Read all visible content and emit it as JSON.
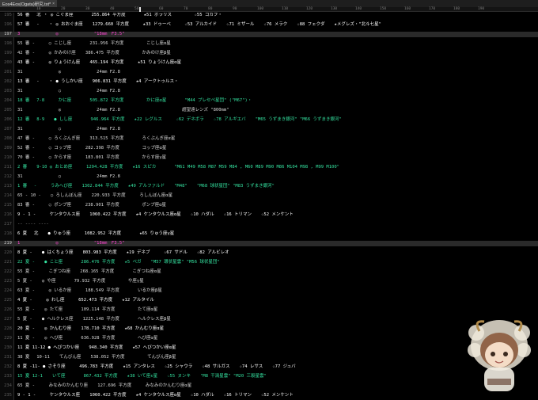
{
  "window": {
    "tab_label": "Eos4Eos(Ogata)研究.txt*"
  },
  "ruler": {
    "ticks": [
      "10",
      "20",
      "30",
      "40",
      "50",
      "60",
      "70",
      "80",
      "90",
      "100",
      "110",
      "120",
      "130",
      "140",
      "150",
      "160",
      "170",
      "180",
      "190"
    ]
  },
  "lines": [
    {
      "n": "195",
      "t": "56 審 　北 ・ ◎ こぐま座 　　　 255.864 平方度 　　　 ★51 ポラリス 　　　　 ☆55 コカブ・"
    },
    {
      "n": "196",
      "t": "57 審 　- 　 ・ ◎ おおぐま座 　 1279.660 平方度 　　 ★33 ドゥーベ 　　 ☆53 アルカイド 　 ☆71 ミザール 　 ☆76 メラク 　 ☆88 フェクダ 　 ★メグレズ・\"北斗七星\""
    },
    {
      "n": "197",
      "t": "3 　　　　　　　 ◎ 　　　　　　　 \"18mm　F3.5\""
    },
    {
      "n": "198",
      "t": "55 審 - 　　 ○ こじし座 　　　 231.956 平方度 　　　　 こじし座α星"
    },
    {
      "n": "199",
      "t": "42 審 - 　　 ◎ かみのけ座 　 386.475 平方度 　　　　 かみのけ座β星"
    },
    {
      "n": "200",
      "t": "43 審 - 　　 ◎ りょうけん座 　 465.194 平方度 　　 ★51 りょうけん座α星"
    },
    {
      "n": "201",
      "t": "31 　　　　　　　 ◎ 　　　　　　　 24mm F2.8"
    },
    {
      "n": "202",
      "t": "13 審 　- 　 ・ ● うしかい座 　 906.831 平方度 　 ★4 アークトゥルス・"
    },
    {
      "n": "203",
      "t": "31 　　　　　　　 ○ 　　　　　　　 24mm F2.8"
    },
    {
      "n": "204",
      "t": "18 審 　7-8 　　 かに座 　　　 505.872 平方度 　　　　 かに座α星 　　　 \"M44 プレセペ星団\" (\"M67\")・"
    },
    {
      "n": "205",
      "t": "31 　　　　　　　 ◎ 　　　　　　　 24mm F2.8 　　　　　　　　　　　　　 超望遠レンズ \"800mm\""
    },
    {
      "n": "206",
      "t": "12 審 　8-9 　 ● しし座 　　　 946.964 平方度 　 ★22 レグルス 　　 ☆62 デネボラ 　 ☆78 アルギエバ 　 \"M65 うずまき銀河\" \"M66 うずまき銀河\""
    },
    {
      "n": "207",
      "t": "31 　　　　　　　 ○ 　　　　　　　 24mm F2.8"
    },
    {
      "n": "208",
      "t": "47 審 - 　　 ○ ろくぶんぎ座 　 313.515 平方度 　　　 ろくぶんぎ座α星"
    },
    {
      "n": "209",
      "t": "52 審 - 　　 ○ コップ座 　　 282.398 平方度 　　　　 コップ座α星"
    },
    {
      "n": "210",
      "t": "70 審 - 　　 ○ からす座 　　 183.801 平方度 　　　　 からす座γ星"
    },
    {
      "n": "211",
      "t": "2 審 　 9-10 ◎ おとめ座 　　 1294.428 平方度 　 ★16 スピカ 　　　 \"M61 M49 M58 M87 M59 M84 , M60 M89 M90 M86 M104 M98 , M99 M100\""
    },
    {
      "n": "212",
      "t": "31 　　　　　　　 ○ 　　　　　　　 24mm F2.8"
    },
    {
      "n": "213",
      "t": "1 審 　- 　　 うみへび座 　 1302.844 平方度 　 ★49 アルファルド 　 \"M48\" 　 \"M68 球状星団\" \"M83 うずまき銀河\""
    },
    {
      "n": "214",
      "t": "65 - 10 - 　 ○ ろしんぼん座 　 220.933 平方度 　　 ろしんぼん座α星"
    },
    {
      "n": "215",
      "t": "83 審 - 　　 ○ ポンプ座 　　 238.901 平方度 　　　　 ポンプ座α星"
    },
    {
      "n": "216",
      "t": "9 - 1 - 　　 ケンタウルス座 　 1060.422 平方度 　 ★4 ケンタウルス座α星 　 ☆10 ハダル 　 ☆16 トリマン 　 ☆52 メンケント"
    },
    {
      "n": "217",
      "t": "-- ---- ----"
    },
    {
      "n": "218",
      "t": "6 夏 　北 　 ● りゅう座 　　 1082.952 平方度 　　　 ★65 りゅう座γ星"
    },
    {
      "n": "219",
      "t": "1 　　　　　　　 ◎ 　　　　　　　 \"18mm　F3.5\""
    },
    {
      "n": "220",
      "t": "8 夏 - 　 ● はくちょう座 　 803.983 平方度 　 ★19 デネブ 　　 ☆67 サドル 　 ☆82 アルビレオ"
    },
    {
      "n": "221",
      "t": "22 夏 - 　 ● こと座 　　　 286.476 平方度 　 ★5 ベガ 　 \"M57 環状星雲\" \"M56 球状星団\""
    },
    {
      "n": "222",
      "t": "55 夏 - 　　 こぎつね座 　 268.165 平方度 　　　 こぎつね座α星"
    },
    {
      "n": "223",
      "t": "5 夏 - 　 ◎ や座 　　　 79.932 平方度 　　　　 や座γ星"
    },
    {
      "n": "224",
      "t": "63 夏 - 　　 ◎ いるか座 　　 188.549 平方度 　　　 いるか座β星"
    },
    {
      "n": "225",
      "t": "4 夏 - 　　 ◎ わし座 　　 652.473 平方度 　 ★12 アルタイル"
    },
    {
      "n": "226",
      "t": "55 夏 - 　 ◎ たて座 　　　 109.114 平方度 　　　　 たて座α星"
    },
    {
      "n": "227",
      "t": "5 夏 - 　 ● ヘルクレス座 　 1225.148 平方度 　　　 ヘルクレス座β星"
    },
    {
      "n": "228",
      "t": "20 夏 - 　 ◎ かんむり座 　 178.710 平方度 　 ★68 かんむり座α星"
    },
    {
      "n": "229",
      "t": "11 夏 - 　 ◎ へび座 　　　 636.928 平方度 　　　　 へび座α星"
    },
    {
      "n": "230",
      "t": "11 夏 11-12 ● へびつかい座 　 948.340 平方度 　 ★57 へびつかい座α星"
    },
    {
      "n": "231",
      "t": "38 夏 　10-11 　 てんびん座 　 538.052 平方度 　　　　 てんびん座β星"
    },
    {
      "n": "232",
      "t": "8 夏 -11- ● さそり座 　　 496.783 平方度 　 ★15 アンタレス 　 ☆25 シャウラ 　 ☆48 サルガス 　 ☆74 レサス 　 ☆77 ジュバ"
    },
    {
      "n": "233",
      "t": "15 夏 12-1 　 いて座 　　　 867.432 平方度 　 ★38 いて座ε星 　 ☆55 ヌンキ 　 \"M8 干潟星雲\" \"M20 三裂星雲\""
    },
    {
      "n": "234",
      "t": "65 夏 - 　　 みなみのかんむり座 　 127.696 平方度 　　 みなみのかんむり座α星"
    },
    {
      "n": "235",
      "t": "9 - 1 - 　　 ケンタウルス座 　 1060.422 平方度 　 ★4 ケンタウルス座α星 　 ☆10 ハダル 　 ☆16 トリマン 　 ☆52 メンケント"
    }
  ]
}
